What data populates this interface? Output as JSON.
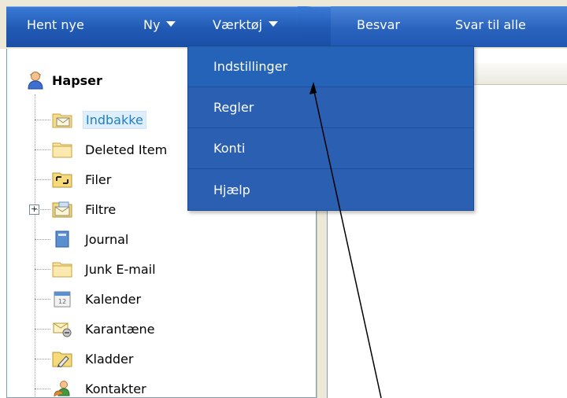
{
  "toolbar": {
    "get_new": "Hent nye",
    "new": "Ny",
    "tools": "Værktøj",
    "reply": "Besvar",
    "reply_all": "Svar til alle"
  },
  "tools_menu": {
    "items": [
      "Indstillinger",
      "Regler",
      "Konti",
      "Hjælp"
    ]
  },
  "account": {
    "name": "Hapser"
  },
  "folders": [
    {
      "label": "Indbakke",
      "icon": "inbox-icon",
      "selected": true
    },
    {
      "label": "Deleted Item",
      "icon": "folder-icon"
    },
    {
      "label": "Filer",
      "icon": "files-folder-icon"
    },
    {
      "label": "Filtre",
      "icon": "filters-icon"
    },
    {
      "label": "Journal",
      "icon": "journal-icon"
    },
    {
      "label": "Junk E-mail",
      "icon": "folder-icon"
    },
    {
      "label": "Kalender",
      "icon": "calendar-icon"
    },
    {
      "label": "Karantæne",
      "icon": "quarantine-icon"
    },
    {
      "label": "Kladder",
      "icon": "drafts-icon"
    },
    {
      "label": "Kontakter",
      "icon": "contacts-icon"
    }
  ],
  "colors": {
    "toolbar_blue": "#2059b4",
    "menu_blue": "#2a5fb2",
    "selected_text": "#1f7fc1"
  }
}
